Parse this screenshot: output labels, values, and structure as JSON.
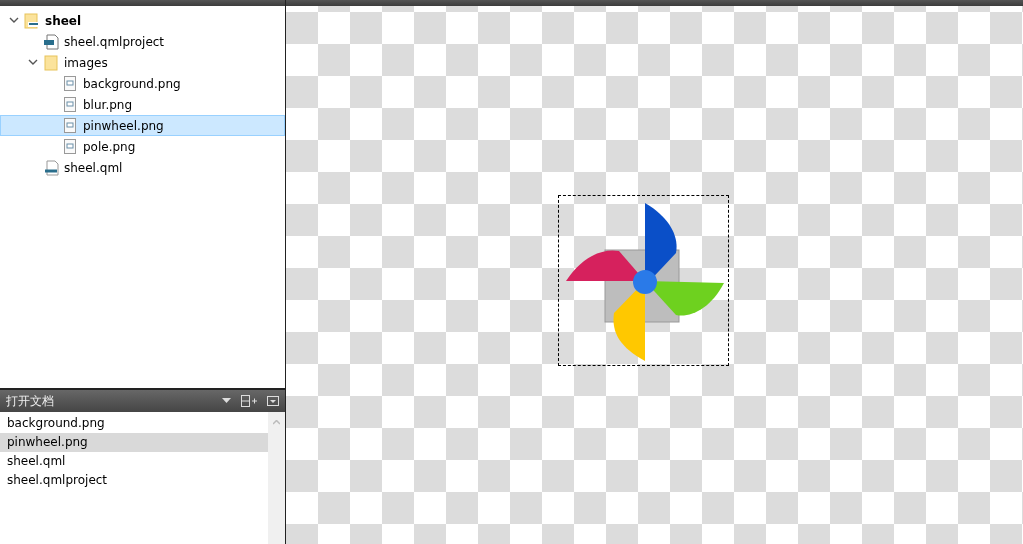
{
  "project_tree": [
    {
      "label": "sheel",
      "kind": "project",
      "expanded": true,
      "selected": false,
      "children": [
        {
          "label": "sheel.qmlproject",
          "kind": "qmlproject",
          "selected": false
        },
        {
          "label": "images",
          "kind": "folder",
          "expanded": true,
          "selected": false,
          "children": [
            {
              "label": "background.png",
              "kind": "image",
              "selected": false
            },
            {
              "label": "blur.png",
              "kind": "image",
              "selected": false
            },
            {
              "label": "pinwheel.png",
              "kind": "image",
              "selected": true
            },
            {
              "label": "pole.png",
              "kind": "image",
              "selected": false
            }
          ]
        },
        {
          "label": "sheel.qml",
          "kind": "qml",
          "selected": false
        }
      ]
    }
  ],
  "open_documents": {
    "title": "打开文档",
    "items": [
      {
        "label": "background.png",
        "selected": false
      },
      {
        "label": "pinwheel.png",
        "selected": true
      },
      {
        "label": "sheel.qml",
        "selected": false
      },
      {
        "label": "sheel.qmlproject",
        "selected": false
      }
    ]
  },
  "image_viewer": {
    "selection_frame": true
  }
}
